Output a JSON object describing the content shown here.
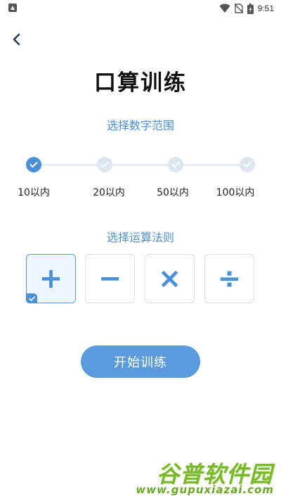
{
  "status_bar": {
    "time": "9:51",
    "icons": [
      "app-notification-icon",
      "wifi-icon",
      "no-sim-icon",
      "battery-charging-icon"
    ]
  },
  "header": {
    "back_icon": "chevron-left-icon",
    "title": "口算训练"
  },
  "range": {
    "label": "选择数字范围",
    "options": [
      {
        "label": "10以内",
        "selected": true
      },
      {
        "label": "20以内",
        "selected": false
      },
      {
        "label": "50以内",
        "selected": false
      },
      {
        "label": "100以内",
        "selected": false
      }
    ]
  },
  "operations": {
    "label": "选择运算法则",
    "options": [
      {
        "symbol": "+",
        "name": "add",
        "selected": true
      },
      {
        "symbol": "−",
        "name": "subtract",
        "selected": false
      },
      {
        "symbol": "×",
        "name": "multiply",
        "selected": false
      },
      {
        "symbol": "÷",
        "name": "divide",
        "selected": false
      }
    ]
  },
  "start_button": {
    "label": "开始训练"
  },
  "watermark": {
    "text": "谷普软件园",
    "url": "www.gupuxiazai.com"
  },
  "colors": {
    "accent": "#4a90d9",
    "button": "#5b9bdb",
    "inactive": "#dce6f0",
    "watermark": "#78b82a"
  }
}
